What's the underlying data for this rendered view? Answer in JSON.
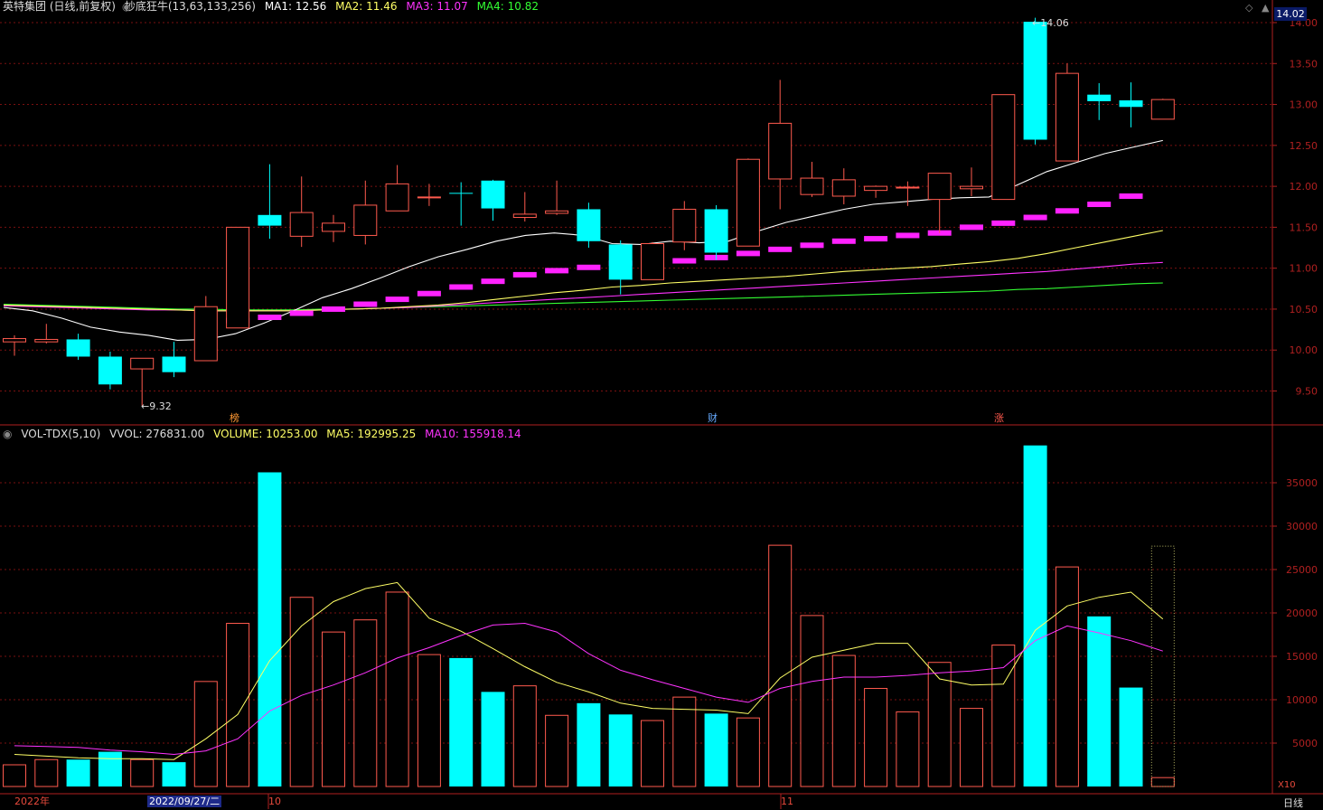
{
  "header": {
    "title": "英特集团 (日线,前复权)",
    "indicator": "抄底狂牛(13,63,133,256)",
    "ma1": "MA1: 12.56",
    "ma2": "MA2: 11.46",
    "ma3": "MA3: 11.07",
    "ma4": "MA4: 10.82"
  },
  "volume_header": {
    "title": "VOL-TDX(5,10)",
    "vvol": "VVOL: 276831.00",
    "volume": "VOLUME: 10253.00",
    "ma5": "MA5: 192995.25",
    "ma10": "MA10: 155918.14"
  },
  "current_price": "14.02",
  "annotations": {
    "high": "14.06",
    "low": "9.32"
  },
  "event_markers": [
    "榜",
    "财",
    "涨"
  ],
  "bottom_axis": {
    "year": "2022年",
    "selected_date": "2022/09/27/二",
    "month1": "10",
    "month2": "11",
    "period": "日线"
  },
  "volume_scale_label": "X10",
  "colors": {
    "up": "#ff5a4e",
    "down": "#00ffff",
    "ma1": "#ffffff",
    "ma2": "#ffff66",
    "ma3": "#ff33ff",
    "ma4": "#33ff33",
    "grid": "#7a1010",
    "axis": "#b02020",
    "custom": "#ff22ff"
  },
  "chart_data": [
    {
      "type": "candlestick",
      "title": "英特集团 (日线,前复权)",
      "y_ticks": [
        9.5,
        10.0,
        10.5,
        11.0,
        11.5,
        12.0,
        12.5,
        13.0,
        13.5,
        14.0
      ],
      "ylim": [
        9.2,
        14.1
      ],
      "candles": [
        {
          "o": 10.1,
          "h": 10.18,
          "l": 9.93,
          "c": 10.14
        },
        {
          "o": 10.1,
          "h": 10.32,
          "l": 10.08,
          "c": 10.13
        },
        {
          "o": 10.13,
          "h": 10.2,
          "l": 9.88,
          "c": 9.92
        },
        {
          "o": 9.92,
          "h": 9.98,
          "l": 9.52,
          "c": 9.58
        },
        {
          "o": 9.77,
          "h": 9.9,
          "l": 9.32,
          "c": 9.9
        },
        {
          "o": 9.92,
          "h": 10.1,
          "l": 9.67,
          "c": 9.73
        },
        {
          "o": 9.87,
          "h": 10.66,
          "l": 9.87,
          "c": 10.53
        },
        {
          "o": 10.27,
          "h": 11.5,
          "l": 10.27,
          "c": 11.5
        },
        {
          "o": 11.65,
          "h": 12.27,
          "l": 11.36,
          "c": 11.52
        },
        {
          "o": 11.39,
          "h": 12.12,
          "l": 11.26,
          "c": 11.68
        },
        {
          "o": 11.45,
          "h": 11.65,
          "l": 11.32,
          "c": 11.55
        },
        {
          "o": 11.4,
          "h": 12.07,
          "l": 11.29,
          "c": 11.77
        },
        {
          "o": 11.7,
          "h": 12.26,
          "l": 11.7,
          "c": 12.03
        },
        {
          "o": 11.87,
          "h": 12.03,
          "l": 11.76,
          "c": 11.87
        },
        {
          "o": 11.92,
          "h": 12.05,
          "l": 11.52,
          "c": 11.91
        },
        {
          "o": 12.07,
          "h": 12.08,
          "l": 11.58,
          "c": 11.73
        },
        {
          "o": 11.62,
          "h": 11.93,
          "l": 11.57,
          "c": 11.66
        },
        {
          "o": 11.67,
          "h": 12.07,
          "l": 11.65,
          "c": 11.7
        },
        {
          "o": 11.72,
          "h": 11.8,
          "l": 11.25,
          "c": 11.33
        },
        {
          "o": 11.29,
          "h": 11.34,
          "l": 10.68,
          "c": 10.86
        },
        {
          "o": 10.86,
          "h": 11.32,
          "l": 10.86,
          "c": 11.3
        },
        {
          "o": 11.32,
          "h": 11.82,
          "l": 11.22,
          "c": 11.72
        },
        {
          "o": 11.72,
          "h": 11.77,
          "l": 11.1,
          "c": 11.19
        },
        {
          "o": 11.27,
          "h": 12.34,
          "l": 11.27,
          "c": 12.33
        },
        {
          "o": 12.09,
          "h": 13.3,
          "l": 11.72,
          "c": 12.77
        },
        {
          "o": 11.9,
          "h": 12.3,
          "l": 11.87,
          "c": 12.1
        },
        {
          "o": 11.88,
          "h": 12.22,
          "l": 11.78,
          "c": 12.08
        },
        {
          "o": 11.95,
          "h": 12.01,
          "l": 11.86,
          "c": 12.0
        },
        {
          "o": 11.98,
          "h": 12.06,
          "l": 11.76,
          "c": 11.99
        },
        {
          "o": 11.84,
          "h": 12.16,
          "l": 11.43,
          "c": 12.16
        },
        {
          "o": 11.97,
          "h": 12.23,
          "l": 11.88,
          "c": 12.0
        },
        {
          "o": 11.84,
          "h": 13.12,
          "l": 11.84,
          "c": 13.12
        },
        {
          "o": 14.01,
          "h": 14.06,
          "l": 12.51,
          "c": 12.57
        },
        {
          "o": 12.31,
          "h": 13.5,
          "l": 12.31,
          "c": 13.38
        },
        {
          "o": 13.12,
          "h": 13.26,
          "l": 12.81,
          "c": 13.04
        },
        {
          "o": 13.05,
          "h": 13.27,
          "l": 12.72,
          "c": 12.97
        },
        {
          "o": 12.82,
          "h": 13.07,
          "l": 12.82,
          "c": 13.06
        }
      ],
      "series": [
        {
          "name": "MA1",
          "values": [
            10.52,
            10.48,
            10.39,
            10.28,
            10.22,
            10.18,
            10.12,
            10.13,
            10.2,
            10.33,
            10.48,
            10.64,
            10.75,
            10.88,
            11.02,
            11.14,
            11.23,
            11.33,
            11.4,
            11.43,
            11.4,
            11.3,
            11.29,
            11.33,
            11.31,
            11.33,
            11.45,
            11.56,
            11.64,
            11.72,
            11.78,
            11.81,
            11.84,
            11.86,
            11.87,
            12.02,
            12.18,
            12.29,
            12.4,
            12.48,
            12.56
          ]
        },
        {
          "name": "MA2",
          "values": [
            10.55,
            10.54,
            10.53,
            10.52,
            10.51,
            10.5,
            10.49,
            10.48,
            10.48,
            10.48,
            10.48,
            10.49,
            10.5,
            10.51,
            10.53,
            10.55,
            10.58,
            10.62,
            10.66,
            10.7,
            10.73,
            10.77,
            10.79,
            10.82,
            10.84,
            10.86,
            10.88,
            10.9,
            10.93,
            10.96,
            10.98,
            11.0,
            11.02,
            11.05,
            11.08,
            11.12,
            11.18,
            11.25,
            11.32,
            11.39,
            11.46
          ]
        },
        {
          "name": "MA3",
          "values": [
            10.54,
            10.53,
            10.52,
            10.51,
            10.5,
            10.49,
            10.49,
            10.48,
            10.48,
            10.48,
            10.48,
            10.49,
            10.5,
            10.51,
            10.52,
            10.54,
            10.56,
            10.58,
            10.6,
            10.62,
            10.64,
            10.66,
            10.68,
            10.7,
            10.72,
            10.74,
            10.76,
            10.78,
            10.8,
            10.82,
            10.84,
            10.86,
            10.88,
            10.9,
            10.92,
            10.94,
            10.96,
            10.99,
            11.02,
            11.05,
            11.07
          ]
        },
        {
          "name": "MA4",
          "values": [
            10.56,
            10.55,
            10.54,
            10.53,
            10.52,
            10.51,
            10.5,
            10.5,
            10.49,
            10.49,
            10.49,
            10.5,
            10.5,
            10.51,
            10.52,
            10.53,
            10.54,
            10.55,
            10.56,
            10.57,
            10.58,
            10.59,
            10.6,
            10.61,
            10.62,
            10.63,
            10.64,
            10.65,
            10.66,
            10.67,
            10.68,
            10.69,
            10.7,
            10.71,
            10.72,
            10.74,
            10.75,
            10.77,
            10.79,
            10.81,
            10.82
          ]
        }
      ],
      "custom_bars": [
        null,
        null,
        null,
        null,
        null,
        null,
        null,
        10.36,
        10.4,
        10.45,
        10.5,
        10.56,
        10.62,
        10.69,
        10.77,
        10.84,
        10.92,
        10.97,
        11.01,
        11.06,
        11.08,
        11.09,
        11.13,
        11.18,
        11.23,
        11.28,
        11.33,
        11.36,
        11.4,
        11.43,
        11.5,
        11.55,
        11.62,
        11.7,
        11.78,
        11.88
      ]
    },
    {
      "type": "bar",
      "title": "VOL-TDX(5,10)",
      "scale": "X10",
      "y_ticks": [
        5000,
        10000,
        15000,
        20000,
        25000,
        30000,
        35000
      ],
      "ylim": [
        0,
        40000
      ],
      "values": [
        2500,
        3100,
        3100,
        4000,
        3100,
        2800,
        12100,
        18800,
        36200,
        21800,
        17800,
        19200,
        22400,
        15200,
        14800,
        10900,
        11600,
        8200,
        9600,
        8300,
        7600,
        10300,
        8400,
        7900,
        27800,
        19700,
        15100,
        11300,
        8600,
        14300,
        9000,
        16300,
        39300,
        25300,
        19600,
        11400,
        1025
      ],
      "ghost_bar": 27700,
      "series": [
        {
          "name": "MA5",
          "values": [
            3700,
            3500,
            3300,
            3200,
            3200,
            3100,
            5500,
            8300,
            14500,
            18500,
            21300,
            22800,
            23500,
            19400,
            17900,
            15900,
            13800,
            12000,
            10900,
            9600,
            9000,
            8900,
            8800,
            8400,
            12500,
            14900,
            15700,
            16500,
            16500,
            12400,
            11700,
            11800,
            18000,
            20800,
            21800,
            22400,
            19300
          ]
        },
        {
          "name": "MA10",
          "values": [
            4700,
            4600,
            4500,
            4200,
            4000,
            3700,
            4100,
            5500,
            8700,
            10500,
            11700,
            13100,
            14800,
            16000,
            17400,
            18600,
            18800,
            17800,
            15300,
            13400,
            12300,
            11300,
            10300,
            9700,
            11300,
            12100,
            12600,
            12600,
            12800,
            13100,
            13300,
            13700,
            16800,
            18500,
            17700,
            16800,
            15600
          ]
        }
      ],
      "x_labels": [
        "2022年",
        "2022/09/27/二",
        "10",
        "11"
      ]
    }
  ]
}
